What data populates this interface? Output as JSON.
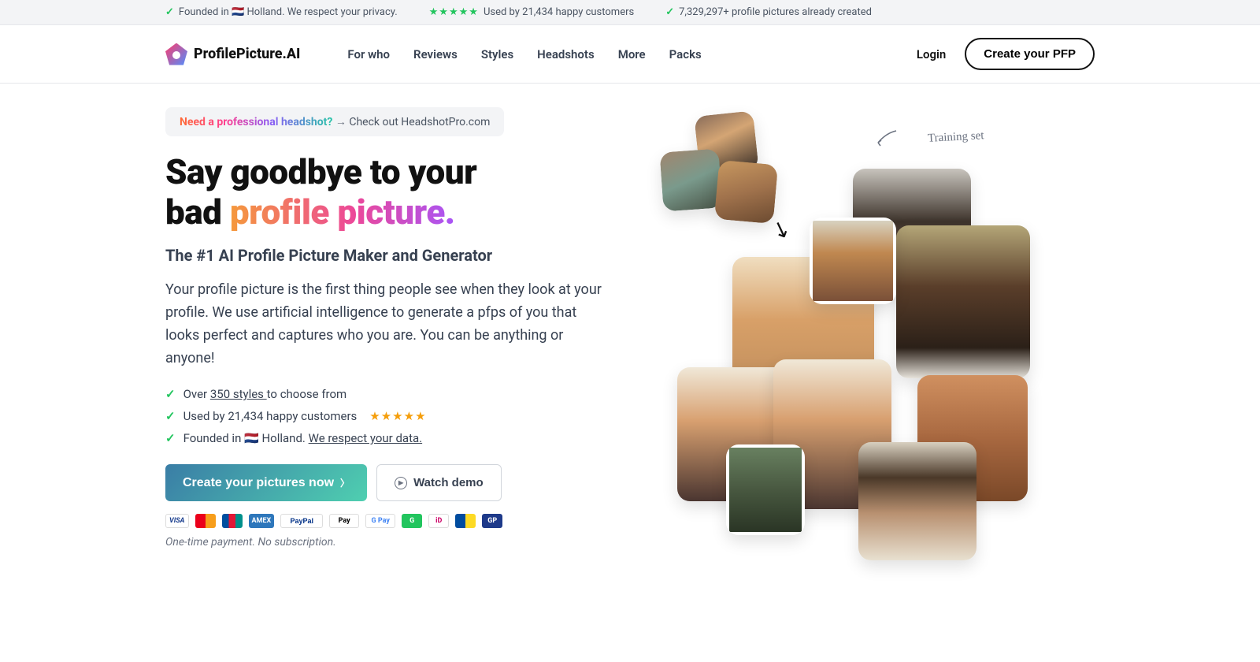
{
  "topbar": {
    "item1": "Founded in 🇳🇱 Holland. We respect your privacy.",
    "item2": "Used by 21,434 happy customers",
    "item3": "7,329,297+ profile pictures already created"
  },
  "logo": "ProfilePicture.AI",
  "nav": {
    "for_who": "For who",
    "reviews": "Reviews",
    "styles": "Styles",
    "headshots": "Headshots",
    "more": "More",
    "packs": "Packs"
  },
  "header": {
    "login": "Login",
    "cta": "Create your PFP"
  },
  "promo": {
    "text": "Need a professional headshot?",
    "arrow": "→",
    "link": "Check out HeadshotPro.com"
  },
  "headline": {
    "line1": "Say goodbye to your",
    "line2a": "bad ",
    "line2b": "profile picture."
  },
  "subhead": "The #1 AI Profile Picture Maker and Generator",
  "body": "Your profile picture is the first thing people see when they look at your profile. We use artificial intelligence to generate a pfps of you that looks perfect and captures who you are. You can be anything or anyone!",
  "features": {
    "f1a": "Over ",
    "f1b": "350 styles ",
    "f1c": "to choose from",
    "f2": "Used by 21,434 happy customers",
    "f3a": "Founded in 🇳🇱 Holland. ",
    "f3b": "We respect your data."
  },
  "cta": {
    "primary": "Create your pictures now",
    "secondary": "Watch demo"
  },
  "payments": [
    "VISA",
    "●●",
    "UP",
    "AMEX",
    "PayPal",
    "Pay",
    "G Pay",
    "G",
    "iD",
    "BC",
    "GP"
  ],
  "fineprint": "One-time payment. No subscription.",
  "training_label": "Training set"
}
